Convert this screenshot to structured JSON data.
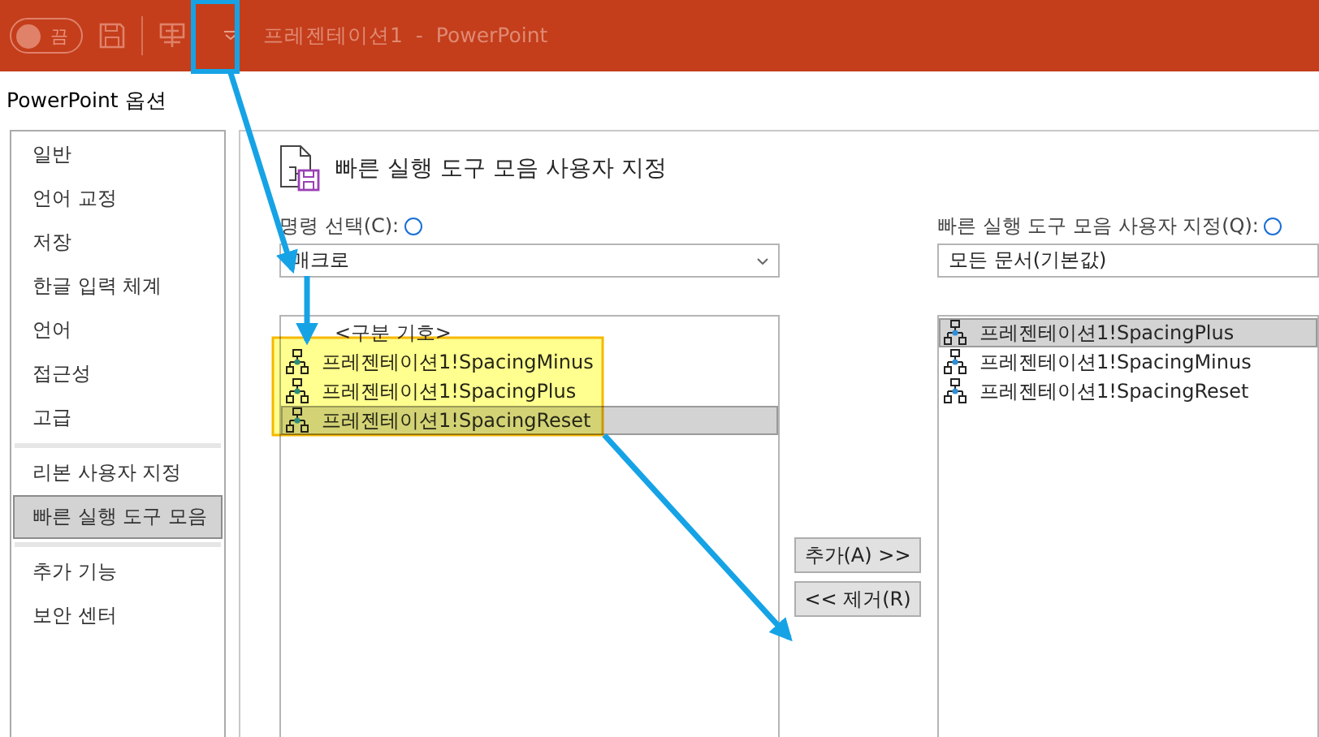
{
  "titlebar": {
    "autosave": {
      "label": "끔",
      "on": false
    },
    "title": "프레젠테이션1",
    "separator": "-",
    "app": "PowerPoint"
  },
  "dialog": {
    "title": "PowerPoint 옵션"
  },
  "nav": {
    "groups": [
      [
        {
          "label": "일반",
          "selected": false
        },
        {
          "label": "언어 교정",
          "selected": false
        },
        {
          "label": "저장",
          "selected": false
        },
        {
          "label": "한글 입력 체계",
          "selected": false
        },
        {
          "label": "언어",
          "selected": false
        },
        {
          "label": "접근성",
          "selected": false
        },
        {
          "label": "고급",
          "selected": false
        }
      ],
      [
        {
          "label": "리본 사용자 지정",
          "selected": false
        },
        {
          "label": "빠른 실행 도구 모음",
          "selected": true
        }
      ],
      [
        {
          "label": "추가 기능",
          "selected": false
        },
        {
          "label": "보안 센터",
          "selected": false
        }
      ]
    ]
  },
  "section": {
    "heading": "빠른 실행 도구 모음 사용자 지정"
  },
  "commands": {
    "label": "명령 선택(C):",
    "dropdown": "매크로",
    "items": [
      {
        "kind": "separator",
        "label": "<구분 기호>",
        "selected": false
      },
      {
        "kind": "macro",
        "label": "프레젠테이션1!SpacingMinus",
        "selected": false
      },
      {
        "kind": "macro",
        "label": "프레젠테이션1!SpacingPlus",
        "selected": false
      },
      {
        "kind": "macro",
        "label": "프레젠테이션1!SpacingReset",
        "selected": true
      }
    ]
  },
  "buttons": [
    {
      "label": "추가(A) >>"
    },
    {
      "label": "<< 제거(R)"
    }
  ],
  "toolbar": {
    "label": "빠른 실행 도구 모음 사용자 지정(Q):",
    "dropdown": "모든 문서(기본값)",
    "items": [
      {
        "kind": "macro",
        "label": "프레젠테이션1!SpacingPlus",
        "selected": true
      },
      {
        "kind": "macro",
        "label": "프레젠테이션1!SpacingMinus",
        "selected": false
      },
      {
        "kind": "macro",
        "label": "프레젠테이션1!SpacingReset",
        "selected": false
      }
    ]
  }
}
